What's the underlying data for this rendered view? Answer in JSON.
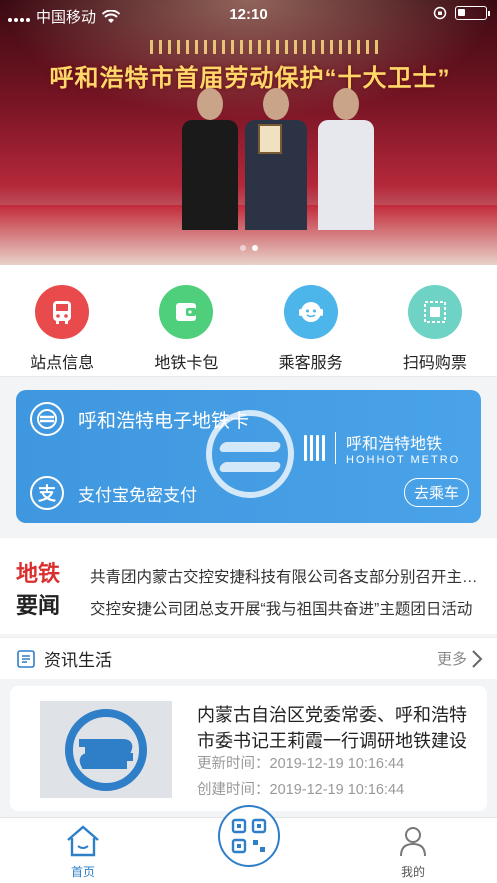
{
  "status_bar": {
    "carrier": "中国移动",
    "time": "12:10",
    "battery_level": 0.25
  },
  "banner": {
    "headline": "呼和浩特市首届劳动保护“十大卫士”",
    "active_slide": 1,
    "slide_count": 2
  },
  "quick_menu": [
    {
      "label": "站点信息",
      "icon": "bus-icon",
      "color": "#e94b4d"
    },
    {
      "label": "地铁卡包",
      "icon": "wallet-icon",
      "color": "#4fcf7b"
    },
    {
      "label": "乘客服务",
      "icon": "service-icon",
      "color": "#4cb5e9"
    },
    {
      "label": "扫码购票",
      "icon": "qr-ticket-icon",
      "color": "#6ed2c4"
    }
  ],
  "metro_card": {
    "title": "呼和浩特电子地铁卡",
    "brand_cn": "呼和浩特地铁",
    "brand_en": "HOHHOT METRO",
    "pay_label": "支付宝免密支付",
    "pay_icon_char": "支",
    "button_label": "去乘车",
    "color": "#3f97df"
  },
  "news_ticker": {
    "title_line1": "地铁",
    "title_line2": "要闻",
    "items": [
      "共青团内蒙古交控安捷科技有限公司各支部分别召开主题团日活动",
      "交控安捷公司团总支开展“我与祖国共奋进”主题团日活动"
    ]
  },
  "section": {
    "title": "资讯生活",
    "more_label": "更多"
  },
  "article": {
    "title": "内蒙古自治区党委常委、呼和浩特市委书记王莉霞一行调研地铁建设",
    "updated": "更新时间：2019-12-19 10:16:44",
    "created": "创建时间：2019-12-19 10:16:44"
  },
  "tab_bar": {
    "home_label": "首页",
    "mine_label": "我的",
    "active": "home"
  }
}
